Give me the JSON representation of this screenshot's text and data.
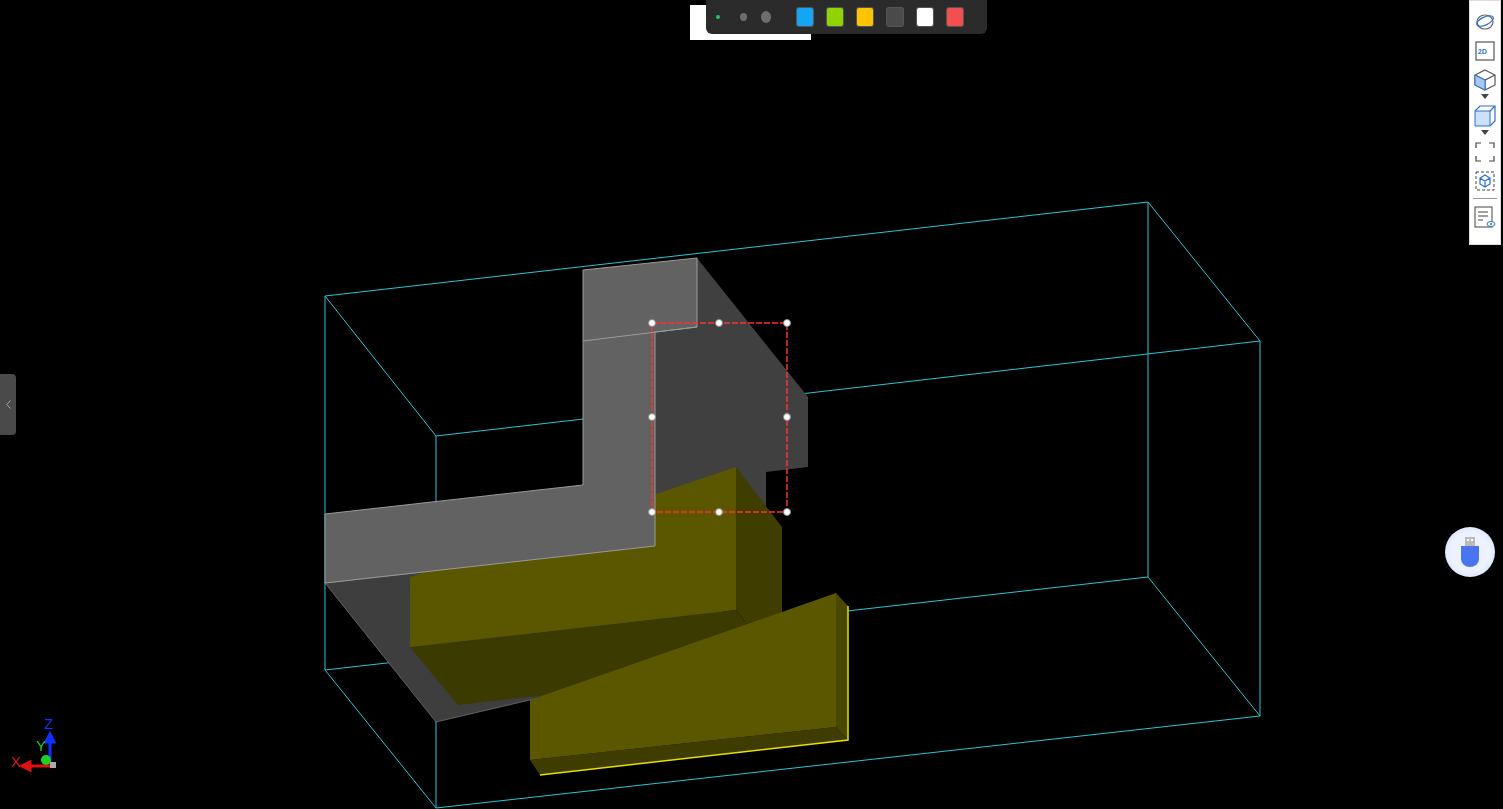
{
  "brush_sizes": [
    {
      "kind": "small",
      "selected": true
    },
    {
      "kind": "medium",
      "selected": false
    },
    {
      "kind": "large",
      "selected": false
    }
  ],
  "colors": [
    {
      "color": "#12a6f5"
    },
    {
      "color": "#8fd400"
    },
    {
      "color": "#ffc300"
    },
    {
      "color": "#4a4a4a"
    },
    {
      "color": "#ffffff"
    },
    {
      "color": "#f25050"
    }
  ],
  "view_toolbar": [
    {
      "kind": "orbit",
      "dropdown": false
    },
    {
      "kind": "flat",
      "label": "2D",
      "dropdown": false
    },
    {
      "kind": "iso",
      "dropdown": true
    },
    {
      "kind": "cube",
      "dropdown": true
    },
    {
      "kind": "fit",
      "dropdown": false
    },
    {
      "kind": "select",
      "dropdown": false
    },
    {
      "kind": "properties",
      "dropdown": false
    }
  ],
  "axes": {
    "x": "X",
    "y": "Y",
    "z": "Z"
  }
}
